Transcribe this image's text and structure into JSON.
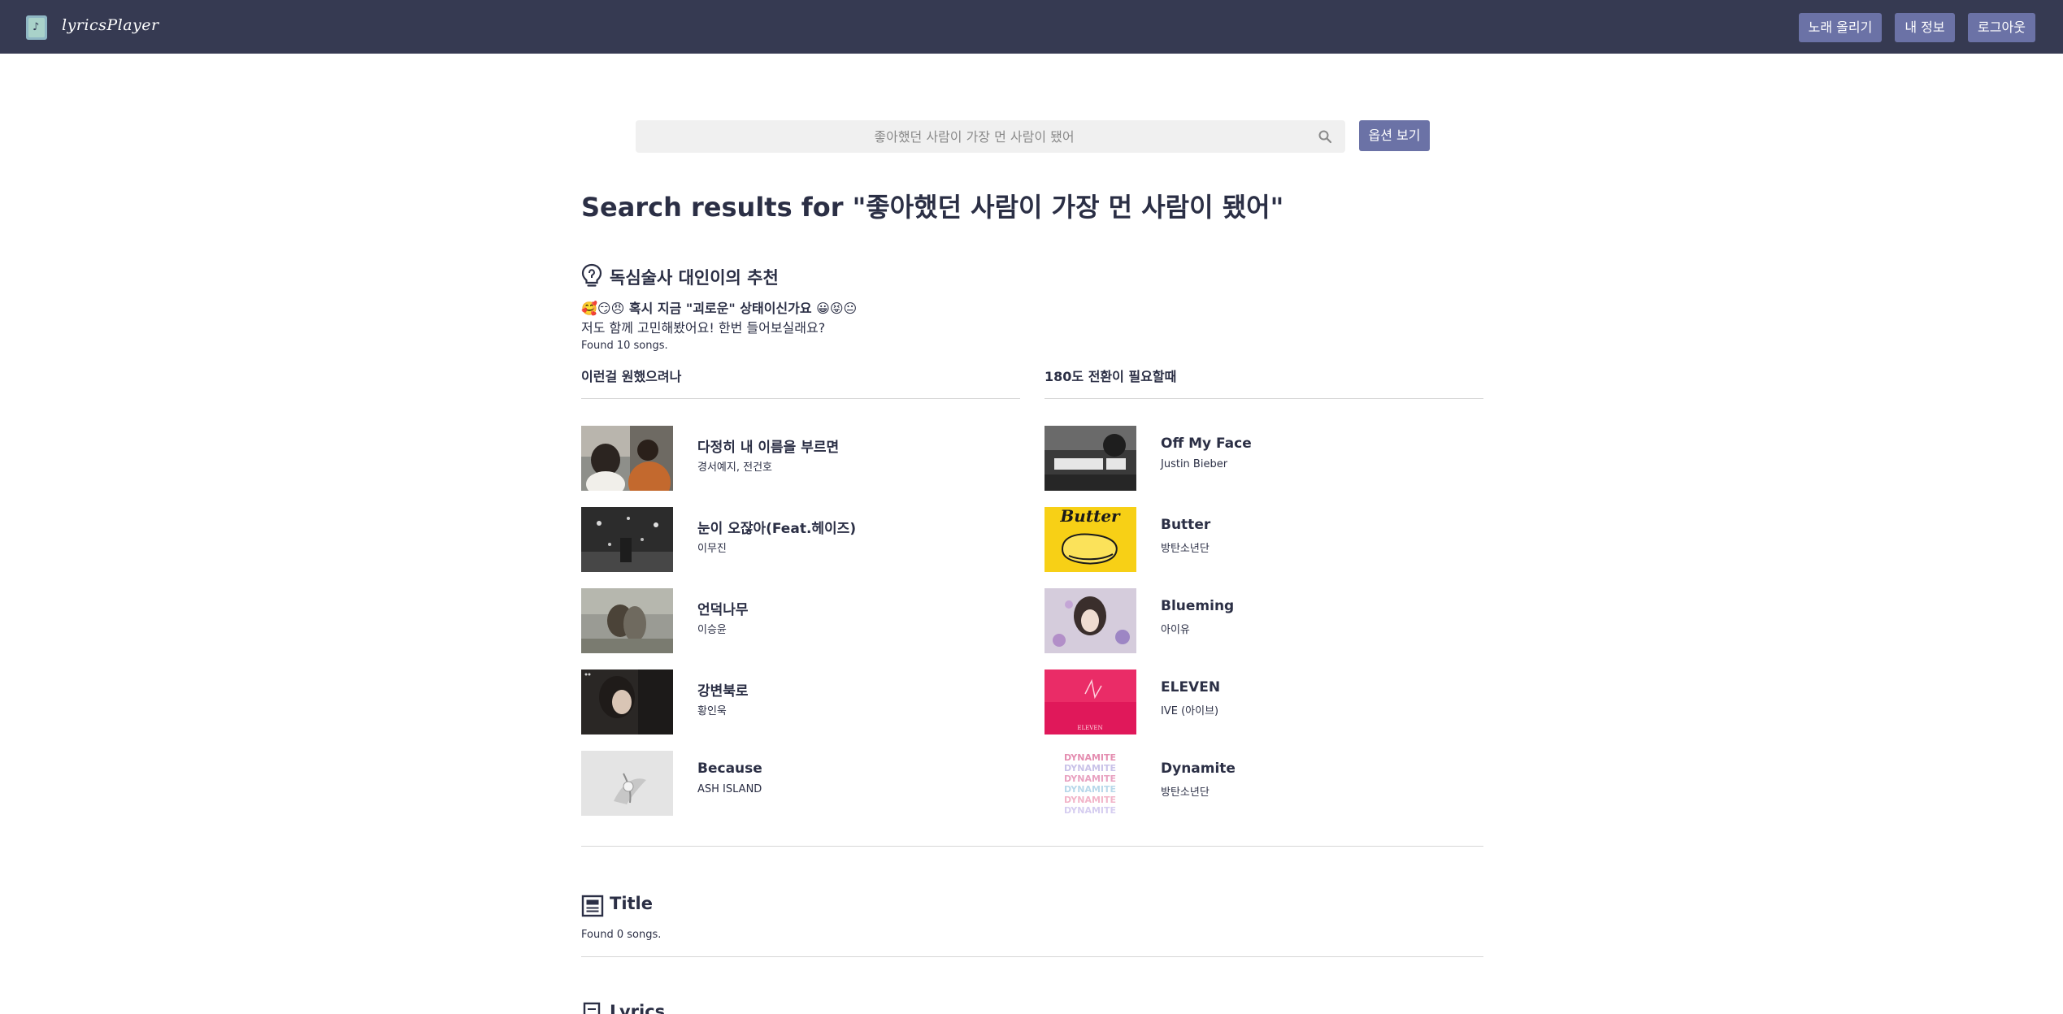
{
  "header": {
    "brand": "lyricsPlayer",
    "upload_label": "노래 올리기",
    "my_info_label": "내 정보",
    "logout_label": "로그아웃"
  },
  "search": {
    "placeholder": "좋아했던 사람이 가장 먼 사람이 됐어",
    "options_label": "옵션 보기"
  },
  "page_title": "Search results for \"좋아했던 사람이 가장 먼 사람이 됐어\"",
  "recommendation": {
    "heading": "독심술사 대인이의 추천",
    "mood_line": "🥰😏😠 혹시 지금 \"괴로운\" 상태이신가요 😀😝😐",
    "sub_line": "저도 함께 고민해봤어요! 한번 들어보실래요?",
    "found": "Found 10 songs.",
    "lists": [
      {
        "heading": "이런걸 원했으려나",
        "songs": [
          {
            "title": "다정히 내 이름을 부르면",
            "artist": "경서예지, 전건호"
          },
          {
            "title": "눈이 오잖아(Feat.헤이즈)",
            "artist": "이무진"
          },
          {
            "title": "언덕나무",
            "artist": "이승윤"
          },
          {
            "title": "강변북로",
            "artist": "황인욱"
          },
          {
            "title": "Because",
            "artist": "ASH ISLAND"
          }
        ]
      },
      {
        "heading": "180도 전환이 필요할때",
        "songs": [
          {
            "title": "Off My Face",
            "artist": "Justin Bieber"
          },
          {
            "title": "Butter",
            "artist": "방탄소년단"
          },
          {
            "title": "Blueming",
            "artist": "아이유"
          },
          {
            "title": "ELEVEN",
            "artist": "IVE (아이브)"
          },
          {
            "title": "Dynamite",
            "artist": "방탄소년단"
          }
        ]
      }
    ]
  },
  "title_section": {
    "heading": "Title",
    "found": "Found 0 songs."
  },
  "lyrics_section": {
    "heading": "Lyrics"
  },
  "cover_art": {
    "butter_text": "Butter",
    "eleven_text": "ELEVEN",
    "dynamite_text": "DYNAMITE"
  },
  "colors": {
    "navbar": "#363a52",
    "button": "#6b72a6",
    "text": "#2b2f45",
    "search_bg": "#f0f0f0"
  },
  "icons": {
    "brand": "music-note-icon",
    "search": "search-icon",
    "recommendation": "lightbulb-icon",
    "title": "newspaper-icon",
    "lyrics": "document-icon"
  }
}
